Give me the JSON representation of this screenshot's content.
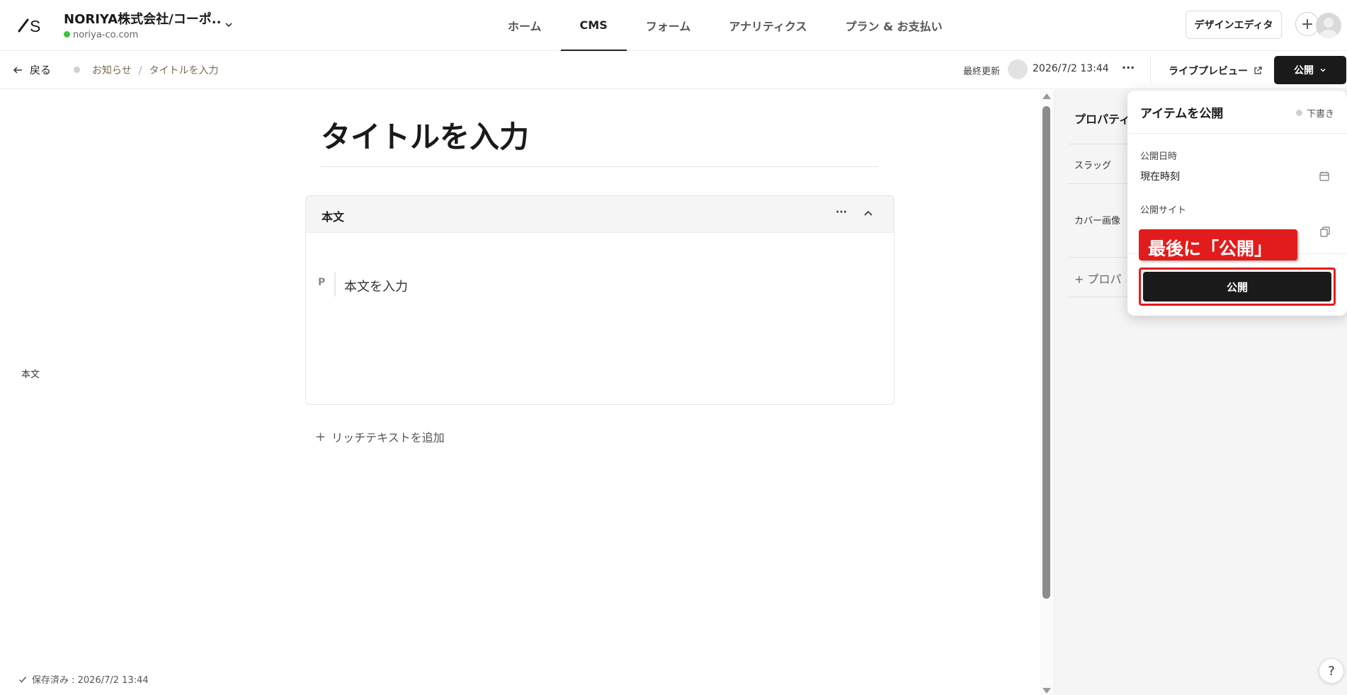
{
  "header": {
    "site_name": "NORIYA株式会社/コーポ...",
    "site_domain": "noriya-co.com",
    "nav": [
      "ホーム",
      "CMS",
      "フォーム",
      "アナリティクス",
      "プラン & お支払い"
    ],
    "design_editor_label": "デザインエディタ",
    "plus_label": "+"
  },
  "subbar": {
    "back_label": "戻る",
    "breadcrumb": [
      "お知らせ",
      "タイトルを入力"
    ],
    "breadcrumb_sep": "/",
    "last_update_label": "最終更新",
    "last_update_time": "2026/7/2 13:44",
    "more_label": "···",
    "live_preview_label": "ライブプレビュー",
    "publish_label": "公開"
  },
  "editor": {
    "title_placeholder": "タイトルを入力",
    "body_card_title": "本文",
    "card_more_label": "···",
    "paragraph_marker": "P",
    "body_placeholder": "本文を入力",
    "add_rich_text_label": "リッチテキストを追加",
    "add_plus": "+",
    "side_label": "本文",
    "saved_status": "保存済み : 2026/7/2 13:44"
  },
  "properties": {
    "title": "プロパティ",
    "slug_label": "スラッグ",
    "cover_label": "カバー画像",
    "add_label": "+ プロパ"
  },
  "publish_popover": {
    "title": "アイテムを公開",
    "status": "下書き",
    "publish_date_label": "公開日時",
    "publish_date_value": "現在時刻",
    "publish_site_label": "公開サイト",
    "publish_button_label": "公開",
    "annotation": "最後に「公開」"
  },
  "help_label": "?",
  "colors": {
    "accent_dark": "#1a1a1a",
    "annotation_red": "#e21c1c",
    "online_green": "#3fc23f"
  }
}
